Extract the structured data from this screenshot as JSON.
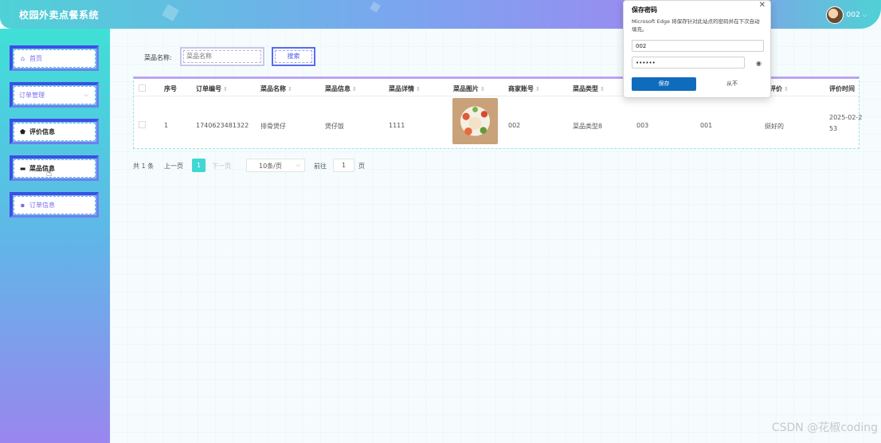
{
  "header": {
    "app_title": "校园外卖点餐系统",
    "user_name": "002",
    "user_chevron": "⌵"
  },
  "sidebar": {
    "items": [
      {
        "label": "首页",
        "icon": "home-icon",
        "glyph": "⌂"
      },
      {
        "label": "订单管理",
        "icon": "chevron-down-icon",
        "glyph": "⌵"
      },
      {
        "label": "评价信息",
        "icon": "pentagon-icon",
        "glyph": "⬟"
      },
      {
        "label": "菜品信息",
        "icon": "folder-icon",
        "glyph": "▬"
      },
      {
        "label": "订单信息",
        "icon": "note-icon",
        "glyph": "▪"
      }
    ]
  },
  "search": {
    "label": "菜品名称:",
    "placeholder": "菜品名称",
    "button_label": "搜索"
  },
  "table": {
    "columns": [
      "序号",
      "订单编号",
      "菜品名称",
      "菜品信息",
      "菜品详情",
      "菜品图片",
      "商家账号",
      "菜品类型",
      "",
      "",
      "评价",
      "评价时间"
    ],
    "sort_glyph": "⇕",
    "rows": [
      {
        "index": "1",
        "order_no": "1740623481322",
        "dish_name": "排骨煲仔",
        "dish_info": "煲仔饭",
        "dish_detail": "1111",
        "merchant": "002",
        "dish_type": "菜品类型8",
        "col9": "003",
        "col10": "001",
        "review": "挺好的",
        "review_time_line1": "2025-02-2",
        "review_time_line2": "53"
      }
    ]
  },
  "pagination": {
    "total": "共 1 条",
    "prev": "上一页",
    "current": "1",
    "next": "下一页",
    "page_size": "10条/页",
    "goto_label": "前往",
    "goto_value": "1",
    "page_suffix": "页"
  },
  "popup": {
    "title": "保存密码",
    "description": "Microsoft Edge 将保存针对此站点的密码并在下次自动填充。",
    "username": "002",
    "password": "••••••",
    "save_label": "保存",
    "never_label": "从不",
    "close_glyph": "✕",
    "eye_glyph": "◉"
  },
  "watermark": "CSDN @花椒coding"
}
